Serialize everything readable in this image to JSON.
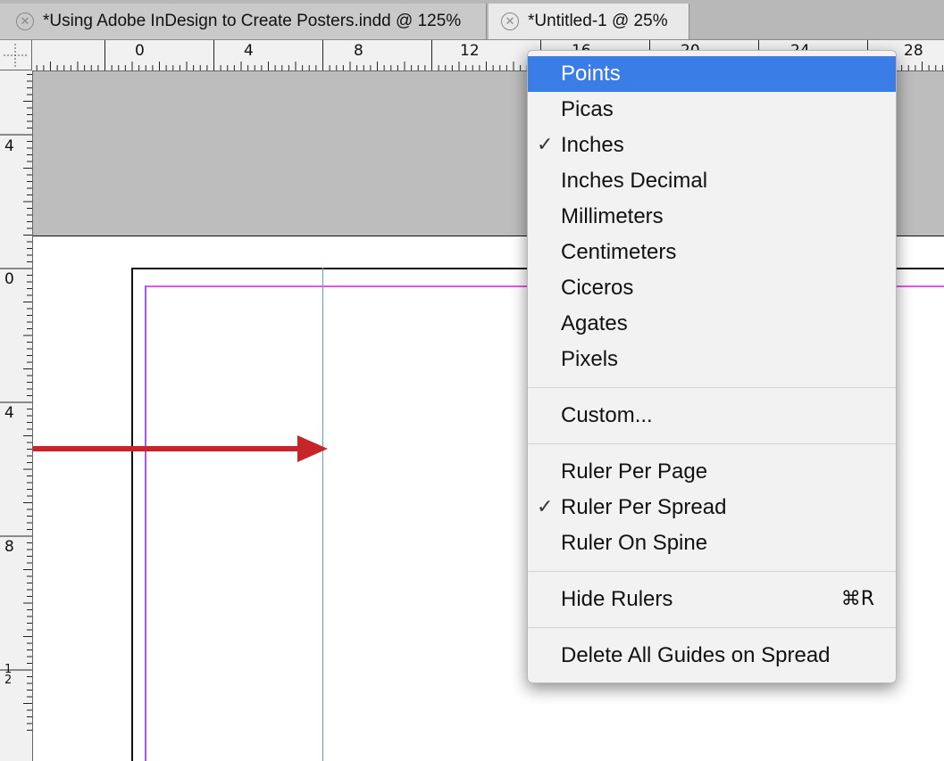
{
  "tabs": [
    {
      "label": "*Using Adobe InDesign to Create Posters.indd @ 125%",
      "state": "inactive"
    },
    {
      "label": "*Untitled-1 @ 25%",
      "state": "active"
    }
  ],
  "horizontal_ruler": {
    "labels": [
      "0",
      "4",
      "8",
      "12",
      "16",
      "20",
      "24",
      "28"
    ]
  },
  "vertical_ruler": {
    "labels": [
      "4",
      "0",
      "4",
      "8",
      "12"
    ]
  },
  "context_menu": {
    "units": [
      {
        "label": "Points",
        "checked": false,
        "highlighted": true
      },
      {
        "label": "Picas",
        "checked": false
      },
      {
        "label": "Inches",
        "checked": true
      },
      {
        "label": "Inches Decimal",
        "checked": false
      },
      {
        "label": "Millimeters",
        "checked": false
      },
      {
        "label": "Centimeters",
        "checked": false
      },
      {
        "label": "Ciceros",
        "checked": false
      },
      {
        "label": "Agates",
        "checked": false
      },
      {
        "label": "Pixels",
        "checked": false
      }
    ],
    "custom": "Custom...",
    "ruler_modes": [
      {
        "label": "Ruler Per Page",
        "checked": false
      },
      {
        "label": "Ruler Per Spread",
        "checked": true
      },
      {
        "label": "Ruler On Spine",
        "checked": false
      }
    ],
    "hide_rulers": {
      "label": "Hide Rulers",
      "shortcut": "⌘R"
    },
    "delete_guides": "Delete All Guides on Spread",
    "checkmark": "✓"
  },
  "colors": {
    "highlight": "#3b7de6",
    "arrow": "#c8252a",
    "guide": "#5a9fe0",
    "margin": "#e455e7"
  }
}
